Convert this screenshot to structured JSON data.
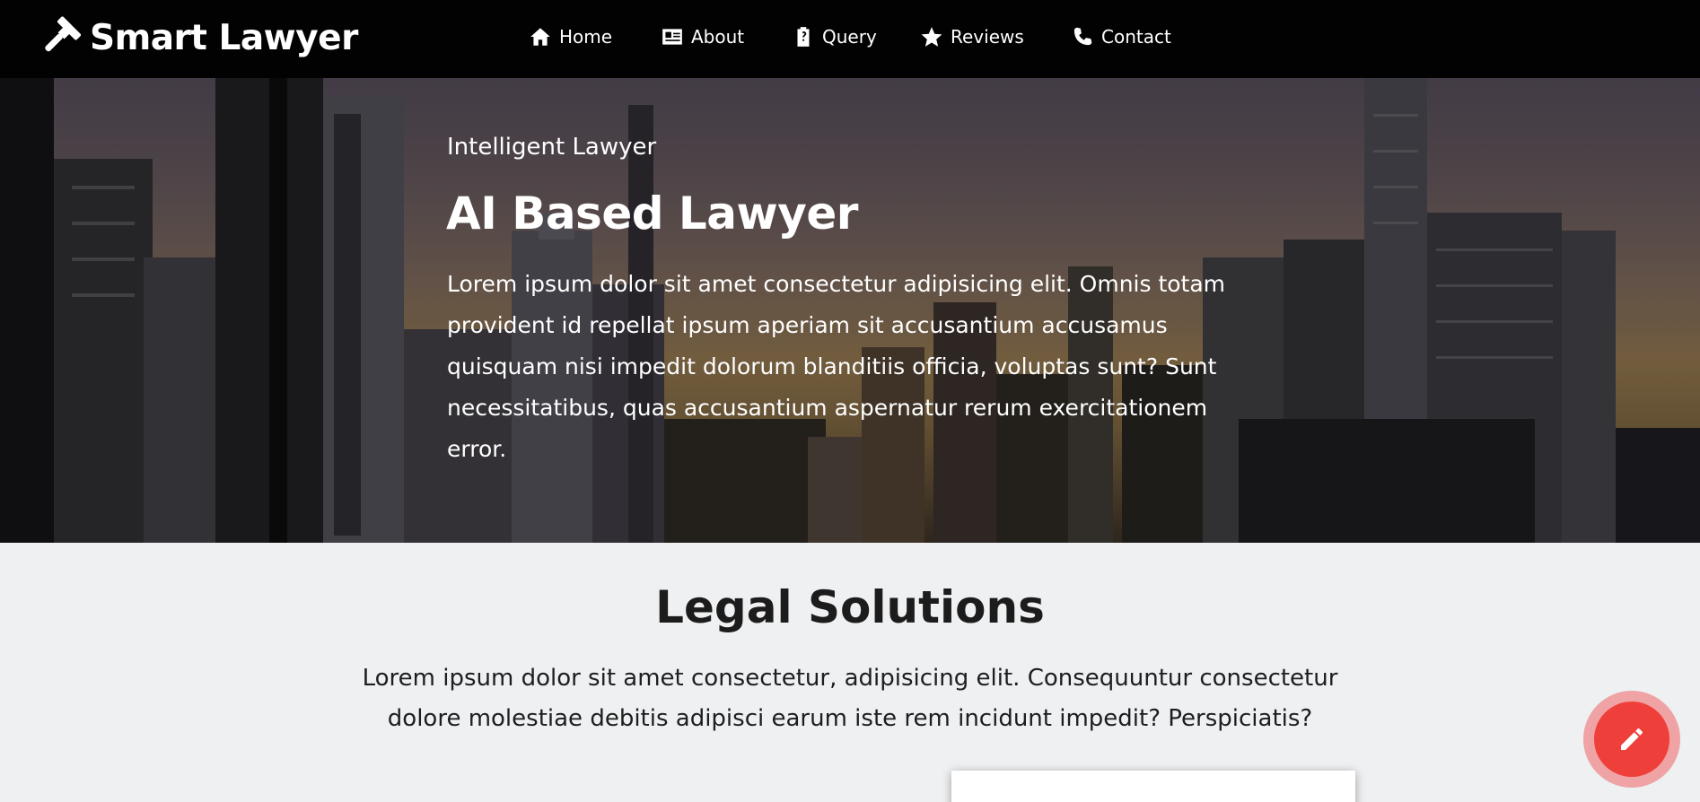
{
  "navbar": {
    "brand": "Smart Lawyer",
    "brand_icon": "gavel-icon",
    "items": [
      {
        "label": "Home",
        "icon": "home-icon"
      },
      {
        "label": "About",
        "icon": "id-card-icon"
      },
      {
        "label": "Query",
        "icon": "clipboard-question-icon"
      },
      {
        "label": "Reviews",
        "icon": "star-icon"
      },
      {
        "label": "Contact",
        "icon": "phone-icon"
      }
    ]
  },
  "hero": {
    "subtitle": "Intelligent Lawyer",
    "title": "AI Based Lawyer",
    "text": "Lorem ipsum dolor sit amet consectetur adipisicing elit. Omnis totam provident id repellat ipsum aperiam sit accusantium accusamus quisquam nisi impedit dolorum blanditiis officia, voluptas sunt? Sunt necessitatibus, quas accusantium aspernatur rerum exercitationem error."
  },
  "solutions": {
    "title": "Legal Solutions",
    "text": "Lorem ipsum dolor sit amet consectetur, adipisicing elit. Consequuntur consectetur dolore molestiae debitis adipisci earum iste rem incidunt impedit? Perspiciatis?"
  },
  "fab": {
    "icon": "pencil-icon"
  },
  "colors": {
    "navbar": "#020202",
    "fab": "#ef3f3a",
    "section_bg": "#eef0f2"
  }
}
